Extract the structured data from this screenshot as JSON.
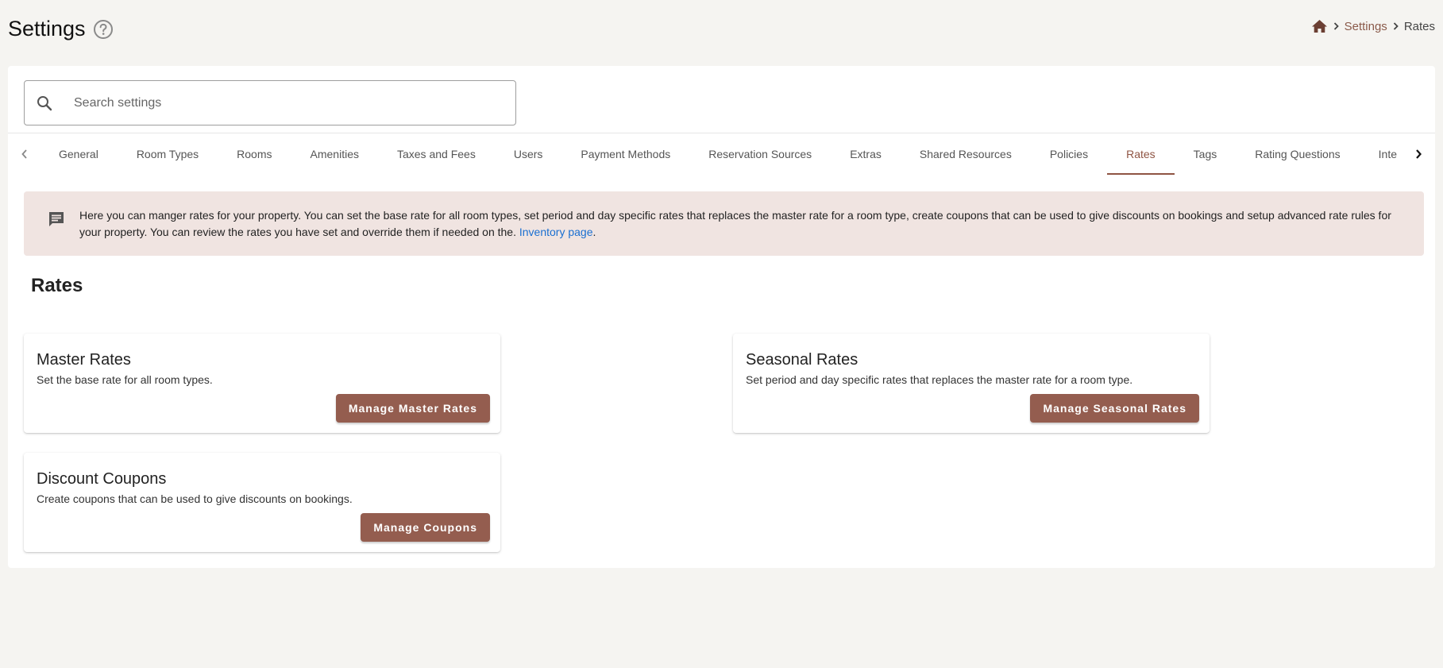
{
  "header": {
    "title": "Settings",
    "breadcrumb": {
      "settings": "Settings",
      "current": "Rates"
    }
  },
  "search": {
    "placeholder": "Search settings",
    "value": ""
  },
  "tabs": [
    {
      "label": "General"
    },
    {
      "label": "Room Types"
    },
    {
      "label": "Rooms"
    },
    {
      "label": "Amenities"
    },
    {
      "label": "Taxes and Fees"
    },
    {
      "label": "Users"
    },
    {
      "label": "Payment Methods"
    },
    {
      "label": "Reservation Sources"
    },
    {
      "label": "Extras"
    },
    {
      "label": "Shared Resources"
    },
    {
      "label": "Policies"
    },
    {
      "label": "Rates"
    },
    {
      "label": "Tags"
    },
    {
      "label": "Rating Questions"
    },
    {
      "label": "Inte"
    }
  ],
  "active_tab": "Rates",
  "info": {
    "text": "Here you can manger rates for your property. You can set the base rate for all room types, set period and day specific rates that replaces the master rate for a room type, create coupons that can be used to give discounts on bookings and setup advanced rate rules for your property. You can review the rates you have set and override them if needed on the.",
    "link": "Inventory page",
    "suffix": "."
  },
  "section": {
    "title": "Rates"
  },
  "cards": {
    "master": {
      "title": "Master Rates",
      "desc": "Set the base rate for all room types.",
      "button": "Manage Master Rates"
    },
    "seasonal": {
      "title": "Seasonal Rates",
      "desc": "Set period and day specific rates that replaces the master rate for a room type.",
      "button": "Manage Seasonal Rates"
    },
    "coupons": {
      "title": "Discount Coupons",
      "desc": "Create coupons that can be used to give discounts on bookings.",
      "button": "Manage Coupons"
    }
  },
  "colors": {
    "accent": "#8f5443",
    "button": "#945d4f",
    "banner": "#f0e4e1",
    "link": "#1a6fd1",
    "background": "#f5f4f1"
  },
  "icons": {
    "help": "help-circle-icon",
    "home": "home-icon",
    "breadcrumb_separator": "chevron-right-icon",
    "search": "search-icon",
    "tab_prev": "chevron-left-icon",
    "tab_next": "chevron-right-icon",
    "info": "message-text-icon"
  }
}
